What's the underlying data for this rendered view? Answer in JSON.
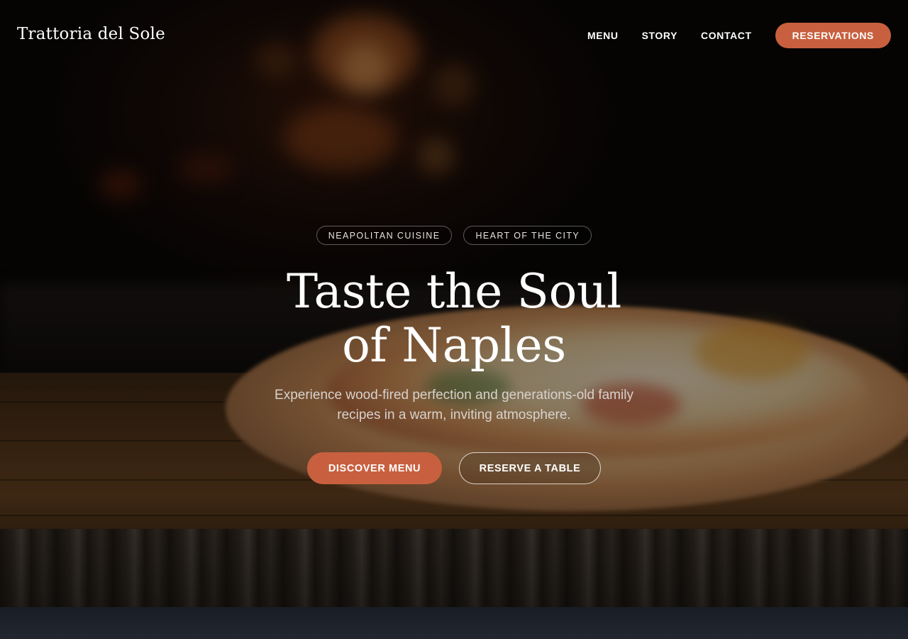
{
  "brand": {
    "name": "Trattoria del Sole"
  },
  "nav": {
    "links": [
      {
        "label": "MENU"
      },
      {
        "label": "STORY"
      },
      {
        "label": "CONTACT"
      }
    ],
    "cta_label": "RESERVATIONS"
  },
  "hero": {
    "tags": [
      {
        "label": "NEAPOLITAN CUISINE"
      },
      {
        "label": "HEART OF THE CITY"
      }
    ],
    "title_line1": "Taste the Soul",
    "title_line2": "of Naples",
    "subtitle_line1": "Experience wood-fired perfection and generations-old family",
    "subtitle_line2": "recipes in a warm, inviting atmosphere.",
    "primary_cta": "DISCOVER MENU",
    "secondary_cta": "RESERVE A TABLE"
  },
  "colors": {
    "accent": "#c8603f",
    "text": "#ffffff",
    "muted_text": "#d8d2cc"
  }
}
